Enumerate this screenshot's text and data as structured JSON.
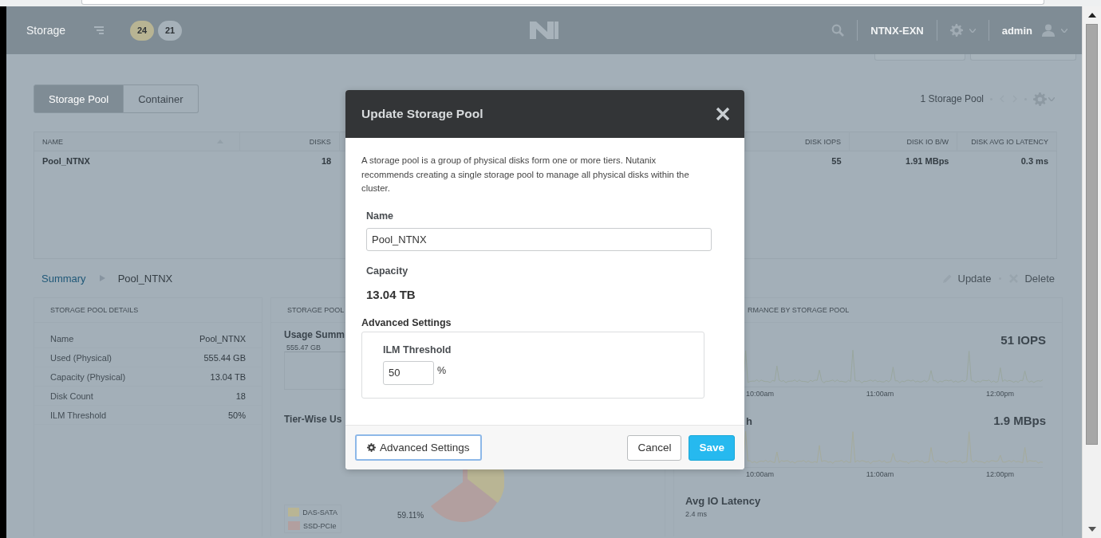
{
  "nav": {
    "title": "Storage",
    "badges": [
      {
        "label": "24",
        "color": "#b8b493"
      },
      {
        "label": "21",
        "color": "#a6b1b9"
      }
    ],
    "cluster": "NTNX-EXN",
    "user": "admin"
  },
  "tabs": [
    {
      "label": "Storage Pool",
      "selected": true
    },
    {
      "label": "Container",
      "selected": false
    }
  ],
  "list_toolbar": {
    "count": "1 Storage Pool"
  },
  "table": {
    "columns": [
      {
        "label": "NAME",
        "sorted": true
      },
      {
        "label": "DISKS",
        "sorted": false
      },
      {
        "label": "DISK IOPS",
        "sorted": false
      },
      {
        "label": "DISK IO B/W",
        "sorted": false
      },
      {
        "label": "DISK AVG IO LATENCY",
        "sorted": false
      }
    ],
    "rows": [
      [
        "Pool_NTNX",
        "18",
        "55",
        "1.91 MBps",
        "0.3 ms"
      ]
    ]
  },
  "breadcrumb": {
    "link": "Summary",
    "current": "Pool_NTNX"
  },
  "actions": [
    {
      "label": "Update",
      "kind": "edit"
    },
    {
      "label": "Delete",
      "kind": "delete"
    }
  ],
  "details": {
    "title": "STORAGE POOL DETAILS",
    "rows": [
      {
        "label": "Name",
        "value": "Pool_NTNX"
      },
      {
        "label": "Used (Physical)",
        "value": "555.44 GB"
      },
      {
        "label": "Capacity (Physical)",
        "value": "13.04 TB"
      },
      {
        "label": "Disk Count",
        "value": "18"
      },
      {
        "label": "ILM Threshold",
        "value": "50%"
      }
    ]
  },
  "usage": {
    "title": "STORAGE POOL",
    "usage_title": "Usage Summ",
    "usage_value": "555.47 GB",
    "tier_title": "Tier-Wise Us",
    "percent": "59.11%",
    "legend": [
      {
        "label": "DAS-SATA",
        "color": "#b9b594"
      },
      {
        "label": "SSD-PCIe",
        "color": "#b29f9f"
      }
    ]
  },
  "performance": {
    "title": "RMANCE BY STORAGE POOL",
    "metrics": [
      {
        "kind": "chart",
        "value": "51 IOPS",
        "times": [
          "10:00am",
          "11:00am",
          "12:00pm"
        ]
      },
      {
        "kind": "chart",
        "title": "h",
        "value": "1.9 MBps",
        "times": [
          "10:00am",
          "11:00am",
          "12:00pm"
        ]
      },
      {
        "kind": "summary",
        "title": "Avg IO Latency",
        "value": "2.4 ms"
      }
    ]
  },
  "modal": {
    "title": "Update Storage Pool",
    "description": "A storage pool is a group of physical disks form one or more tiers. Nutanix recommends creating a single storage pool to manage all physical disks within the cluster.",
    "name_label": "Name",
    "name_value": "Pool_NTNX",
    "capacity_label": "Capacity",
    "capacity_value": "13.04 TB",
    "advanced_title": "Advanced Settings",
    "ilm_label": "ILM Threshold",
    "ilm_value": "50",
    "ilm_unit": "%",
    "buttons": [
      {
        "label": "Advanced Settings",
        "kind": "settings"
      },
      {
        "label": "Cancel",
        "kind": "secondary"
      },
      {
        "label": "Save",
        "kind": "primary"
      }
    ]
  }
}
